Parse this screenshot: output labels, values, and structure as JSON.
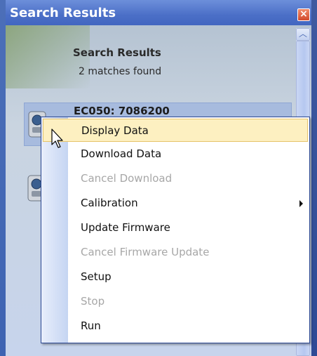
{
  "panel": {
    "title": "Search Results",
    "close_label": "×",
    "heading": "Search Results",
    "match_count": "2",
    "match_text": "matches found"
  },
  "devices": [
    {
      "name": "EC050: 7086200",
      "selected": true
    },
    {
      "name": "",
      "selected": false
    }
  ],
  "context_menu": {
    "items": [
      {
        "label": "Display Data",
        "enabled": true,
        "hover": true
      },
      {
        "label": "Download Data",
        "enabled": true
      },
      {
        "label": "Cancel Download",
        "enabled": false
      },
      {
        "label": "Calibration",
        "enabled": true,
        "submenu": true
      },
      {
        "label": "Update Firmware",
        "enabled": true
      },
      {
        "label": "Cancel Firmware Update",
        "enabled": false
      },
      {
        "label": "Setup",
        "enabled": true
      },
      {
        "label": "Stop",
        "enabled": false
      },
      {
        "label": "Run",
        "enabled": true
      }
    ]
  },
  "colors": {
    "titlebar": "#4b6fc7",
    "menu_hover": "#fdf0c1",
    "disabled_text": "#a7a7a7"
  }
}
